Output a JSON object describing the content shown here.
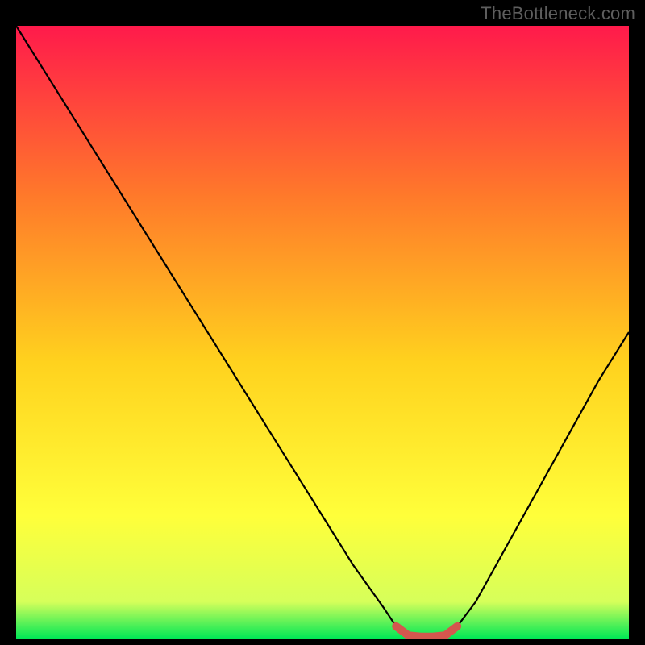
{
  "attribution": "TheBottleneck.com",
  "chart_data": {
    "type": "line",
    "title": "",
    "xlabel": "",
    "ylabel": "",
    "xlim": [
      0,
      100
    ],
    "ylim": [
      0,
      100
    ],
    "grid": false,
    "legend": false,
    "background_gradient": {
      "top": "#ff1a4b",
      "mid1": "#ff7a2a",
      "mid2": "#ffd21e",
      "mid3": "#ffff3a",
      "bottom": "#00e756"
    },
    "series": [
      {
        "name": "bottleneck-curve",
        "color": "#000000",
        "x": [
          0,
          5,
          10,
          15,
          20,
          25,
          30,
          35,
          40,
          45,
          50,
          55,
          60,
          62,
          64,
          66,
          68,
          70,
          72,
          75,
          80,
          85,
          90,
          95,
          100
        ],
        "y": [
          100,
          92,
          84,
          76,
          68,
          60,
          52,
          44,
          36,
          28,
          20,
          12,
          5,
          2,
          0.5,
          0.3,
          0.3,
          0.5,
          2,
          6,
          15,
          24,
          33,
          42,
          50
        ]
      }
    ],
    "marker": {
      "name": "optimal-range",
      "color": "#d4574e",
      "x": [
        62,
        64,
        66,
        68,
        70,
        72
      ],
      "y": [
        2,
        0.5,
        0.3,
        0.3,
        0.5,
        2
      ]
    }
  }
}
